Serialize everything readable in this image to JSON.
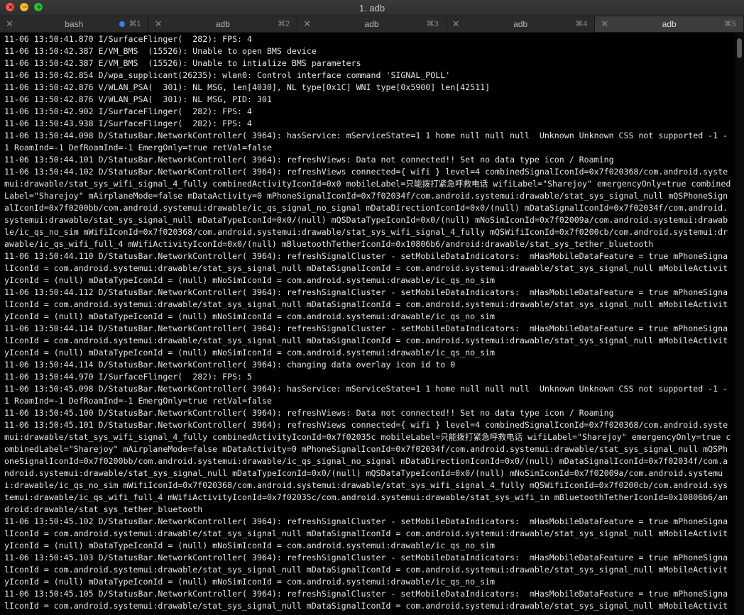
{
  "window": {
    "title": "1. adb"
  },
  "tabs": [
    {
      "label": "bash",
      "shortcut": "⌘1",
      "active": false,
      "dot": true
    },
    {
      "label": "adb",
      "shortcut": "⌘2",
      "active": false,
      "dot": false
    },
    {
      "label": "adb",
      "shortcut": "⌘3",
      "active": false,
      "dot": false
    },
    {
      "label": "adb",
      "shortcut": "⌘4",
      "active": false,
      "dot": false
    },
    {
      "label": "adb",
      "shortcut": "⌘5",
      "active": true,
      "dot": false
    }
  ],
  "colors": {
    "activity_dot": "#3d7cf5",
    "close": "#fe5f57",
    "minimize": "#febc2e",
    "maximize": "#28c840"
  },
  "log_lines": [
    "11-06 13:50:41.870 I/SurfaceFlinger(  282): FPS: 4",
    "11-06 13:50:42.387 E/VM_BMS  (15526): Unable to open BMS device",
    "11-06 13:50:42.387 E/VM_BMS  (15526): Unable to intialize BMS parameters",
    "11-06 13:50:42.854 D/wpa_supplicant(26235): wlan0: Control interface command 'SIGNAL_POLL'",
    "11-06 13:50:42.876 V/WLAN_PSA(  301): NL MSG, len[4030], NL type[0x1C] WNI type[0x5900] len[42511]",
    "11-06 13:50:42.876 V/WLAN_PSA(  301): NL MSG, PID: 301",
    "11-06 13:50:42.902 I/SurfaceFlinger(  282): FPS: 4",
    "11-06 13:50:43.938 I/SurfaceFlinger(  282): FPS: 4",
    "11-06 13:50:44.098 D/StatusBar.NetworkController( 3964): hasService: mServiceState=1 1 home null null null  Unknown Unknown CSS not supported -1 -1 RoamInd=-1 DefRoamInd=-1 EmergOnly=true retVal=false",
    "11-06 13:50:44.101 D/StatusBar.NetworkController( 3964): refreshViews: Data not connected!! Set no data type icon / Roaming",
    "11-06 13:50:44.102 D/StatusBar.NetworkController( 3964): refreshViews connected={ wifi } level=4 combinedSignalIconId=0x7f020368/com.android.systemui:drawable/stat_sys_wifi_signal_4_fully combinedActivityIconId=0x0 mobileLabel=只能拨打紧急呼救电话 wifiLabel=\"Sharejoy\" emergencyOnly=true combinedLabel=\"Sharejoy\" mAirplaneMode=false mDataActivity=0 mPhoneSignalIconId=0x7f02034f/com.android.systemui:drawable/stat_sys_signal_null mQSPhoneSignalIconId=0x7f0200bb/com.android.systemui:drawable/ic_qs_signal_no_signal mDataDirectionIconId=0x0/(null) mDataSignalIconId=0x7f02034f/com.android.systemui:drawable/stat_sys_signal_null mDataTypeIconId=0x0/(null) mQSDataTypeIconId=0x0/(null) mNoSimIconId=0x7f02009a/com.android.systemui:drawable/ic_qs_no_sim mWifiIconId=0x7f020368/com.android.systemui:drawable/stat_sys_wifi_signal_4_fully mQSWifiIconId=0x7f0200cb/com.android.systemui:drawable/ic_qs_wifi_full_4 mWifiActivityIconId=0x0/(null) mBluetoothTetherIconId=0x10806b6/android:drawable/stat_sys_tether_bluetooth",
    "11-06 13:50:44.110 D/StatusBar.NetworkController( 3964): refreshSignalCluster - setMobileDataIndicators:  mHasMobileDataFeature = true mPhoneSignalIconId = com.android.systemui:drawable/stat_sys_signal_null mDataSignalIconId = com.android.systemui:drawable/stat_sys_signal_null mMobileActivityIconId = (null) mDataTypeIconId = (null) mNoSimIconId = com.android.systemui:drawable/ic_qs_no_sim",
    "11-06 13:50:44.112 D/StatusBar.NetworkController( 3964): refreshSignalCluster - setMobileDataIndicators:  mHasMobileDataFeature = true mPhoneSignalIconId = com.android.systemui:drawable/stat_sys_signal_null mDataSignalIconId = com.android.systemui:drawable/stat_sys_signal_null mMobileActivityIconId = (null) mDataTypeIconId = (null) mNoSimIconId = com.android.systemui:drawable/ic_qs_no_sim",
    "11-06 13:50:44.114 D/StatusBar.NetworkController( 3964): refreshSignalCluster - setMobileDataIndicators:  mHasMobileDataFeature = true mPhoneSignalIconId = com.android.systemui:drawable/stat_sys_signal_null mDataSignalIconId = com.android.systemui:drawable/stat_sys_signal_null mMobileActivityIconId = (null) mDataTypeIconId = (null) mNoSimIconId = com.android.systemui:drawable/ic_qs_no_sim",
    "11-06 13:50:44.114 D/StatusBar.NetworkController( 3964): changing data overlay icon id to 0",
    "11-06 13:50:44.970 I/SurfaceFlinger(  282): FPS: 5",
    "11-06 13:50:45.098 D/StatusBar.NetworkController( 3964): hasService: mServiceState=1 1 home null null null  Unknown Unknown CSS not supported -1 -1 RoamInd=-1 DefRoamInd=-1 EmergOnly=true retVal=false",
    "11-06 13:50:45.100 D/StatusBar.NetworkController( 3964): refreshViews: Data not connected!! Set no data type icon / Roaming",
    "11-06 13:50:45.101 D/StatusBar.NetworkController( 3964): refreshViews connected={ wifi } level=4 combinedSignalIconId=0x7f020368/com.android.systemui:drawable/stat_sys_wifi_signal_4_fully combinedActivityIconId=0x7f02035c mobileLabel=只能拨打紧急呼救电话 wifiLabel=\"Sharejoy\" emergencyOnly=true combinedLabel=\"Sharejoy\" mAirplaneMode=false mDataActivity=0 mPhoneSignalIconId=0x7f02034f/com.android.systemui:drawable/stat_sys_signal_null mQSPhoneSignalIconId=0x7f0200bb/com.android.systemui:drawable/ic_qs_signal_no_signal mDataDirectionIconId=0x0/(null) mDataSignalIconId=0x7f02034f/com.android.systemui:drawable/stat_sys_signal_null mDataTypeIconId=0x0/(null) mQSDataTypeIconId=0x0/(null) mNoSimIconId=0x7f02009a/com.android.systemui:drawable/ic_qs_no_sim mWifiIconId=0x7f020368/com.android.systemui:drawable/stat_sys_wifi_signal_4_fully mQSWifiIconId=0x7f0200cb/com.android.systemui:drawable/ic_qs_wifi_full_4 mWifiActivityIconId=0x7f02035c/com.android.systemui:drawable/stat_sys_wifi_in mBluetoothTetherIconId=0x10806b6/android:drawable/stat_sys_tether_bluetooth",
    "11-06 13:50:45.102 D/StatusBar.NetworkController( 3964): refreshSignalCluster - setMobileDataIndicators:  mHasMobileDataFeature = true mPhoneSignalIconId = com.android.systemui:drawable/stat_sys_signal_null mDataSignalIconId = com.android.systemui:drawable/stat_sys_signal_null mMobileActivityIconId = (null) mDataTypeIconId = (null) mNoSimIconId = com.android.systemui:drawable/ic_qs_no_sim",
    "11-06 13:50:45.103 D/StatusBar.NetworkController( 3964): refreshSignalCluster - setMobileDataIndicators:  mHasMobileDataFeature = true mPhoneSignalIconId = com.android.systemui:drawable/stat_sys_signal_null mDataSignalIconId = com.android.systemui:drawable/stat_sys_signal_null mMobileActivityIconId = (null) mDataTypeIconId = (null) mNoSimIconId = com.android.systemui:drawable/ic_qs_no_sim",
    "11-06 13:50:45.105 D/StatusBar.NetworkController( 3964): refreshSignalCluster - setMobileDataIndicators:  mHasMobileDataFeature = true mPhoneSignalIconId = com.android.systemui:drawable/stat_sys_signal_null mDataSignalIconId = com.android.systemui:drawable/stat_sys_signal_null mMobileActivity"
  ]
}
